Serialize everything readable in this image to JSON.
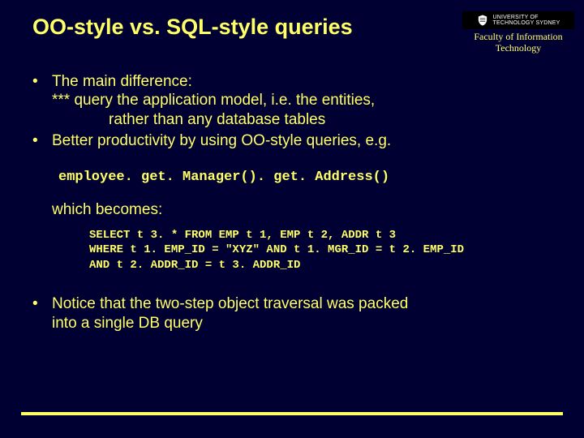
{
  "header": {
    "title": "OO-style vs. SQL-style queries",
    "logo_line1": "UNIVERSITY OF",
    "logo_line2": "TECHNOLOGY SYDNEY",
    "faculty_line1": "Faculty of Information",
    "faculty_line2": "Technology"
  },
  "bullets": {
    "b1": "The main difference:",
    "b1_sub1": "*** query the application model, i.e. the entities,",
    "b1_sub2": "rather than any database tables",
    "b2": "Better productivity by using OO-style queries, e.g."
  },
  "code_inline": "employee. get. Manager(). get. Address()",
  "which_becomes": "which becomes:",
  "sql_line1": "SELECT t 3. * FROM EMP t 1, EMP t 2, ADDR t 3",
  "sql_line2": "WHERE t 1. EMP_ID = \"XYZ\" AND t 1. MGR_ID = t 2. EMP_ID",
  "sql_line3": "AND t 2. ADDR_ID = t 3. ADDR_ID",
  "b3_line1": "Notice that the two-step object traversal was packed",
  "b3_line2": "into a single DB query"
}
